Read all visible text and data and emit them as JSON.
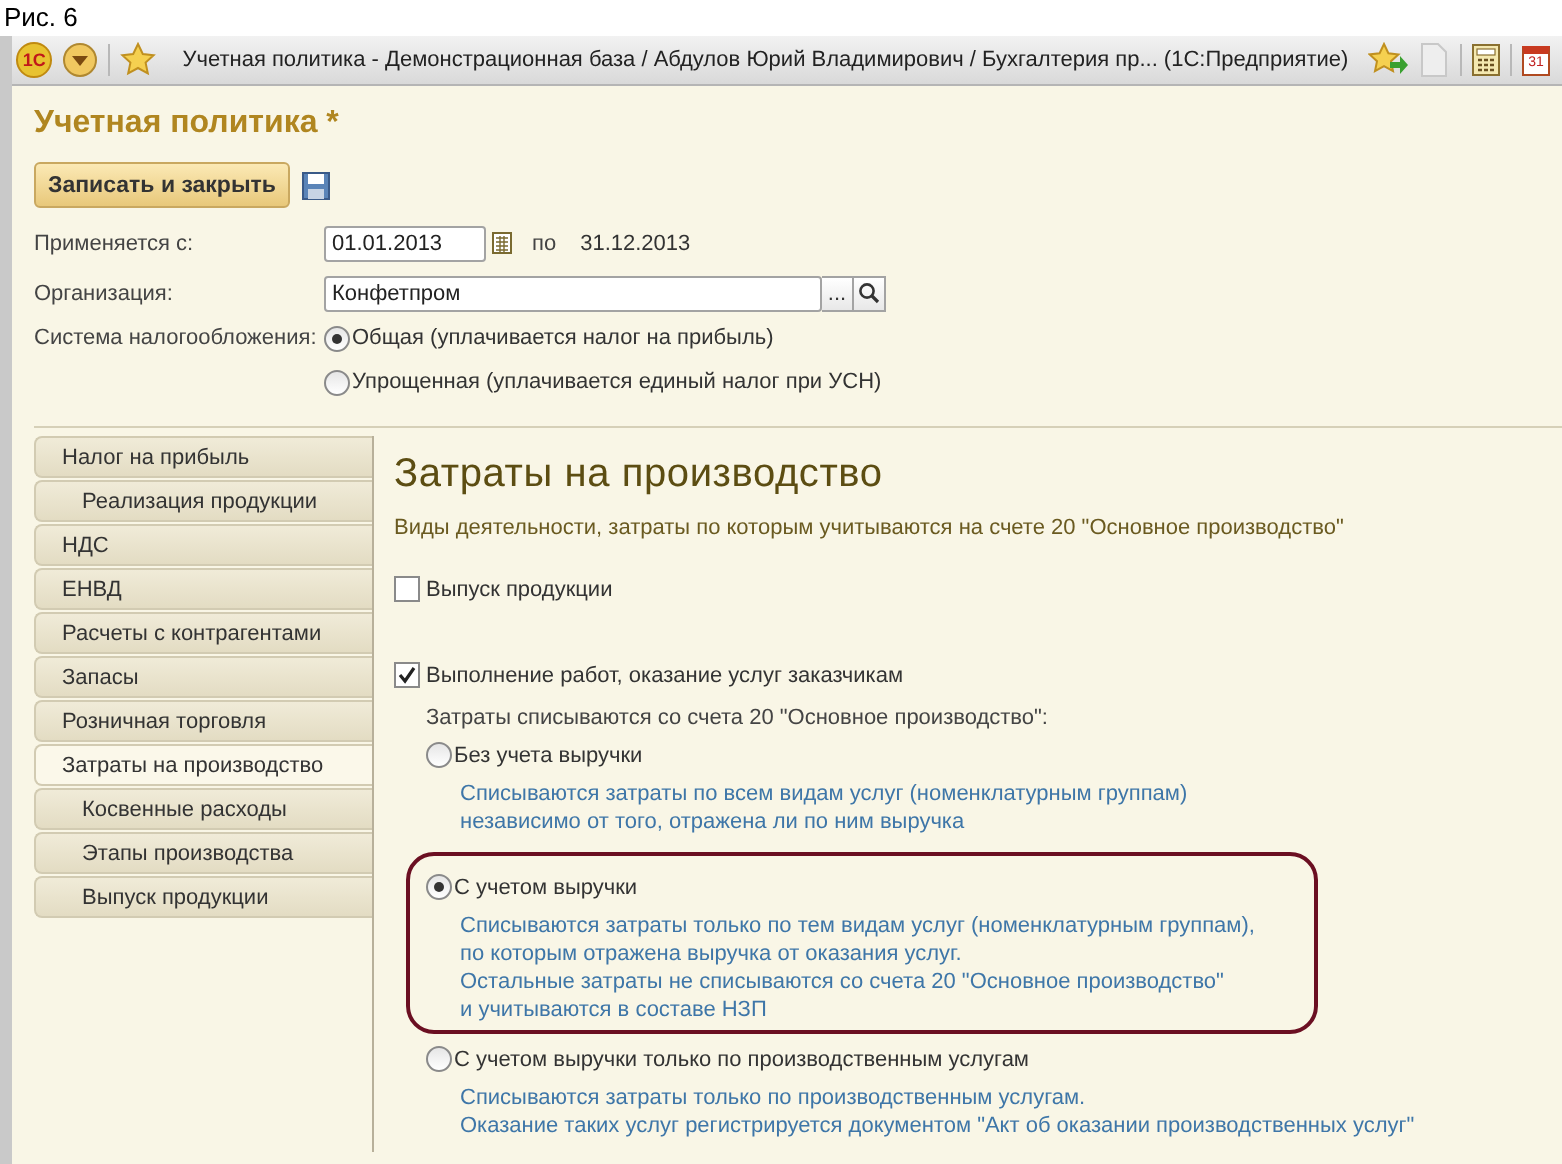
{
  "caption": "Рис. 6",
  "window": {
    "logo": "1С",
    "title": "Учетная политика - Демонстрационная база / Абдулов Юрий Владимирович / Бухгалтерия пр...  (1С:Предприятие)",
    "calendar_day": "31"
  },
  "form": {
    "title": "Учетная политика *",
    "save_close_button": "Записать и закрыть",
    "period": {
      "label": "Применяется с:",
      "from": "01.01.2013",
      "to_label": "по",
      "to": "31.12.2013"
    },
    "organization": {
      "label": "Организация:",
      "value": "Конфетпром",
      "select_button": "..."
    },
    "tax_system": {
      "label": "Система налогообложения:",
      "options": [
        {
          "label": "Общая (уплачивается налог на прибыль)",
          "selected": true
        },
        {
          "label": "Упрощенная (уплачивается единый налог при УСН)",
          "selected": false
        }
      ]
    }
  },
  "sections": [
    {
      "label": "Налог на прибыль",
      "selected": false,
      "children": [
        {
          "label": "Реализация продукции",
          "selected": false
        }
      ]
    },
    {
      "label": "НДС",
      "selected": false
    },
    {
      "label": "ЕНВД",
      "selected": false
    },
    {
      "label": "Расчеты с контрагентами",
      "selected": false
    },
    {
      "label": "Запасы",
      "selected": false
    },
    {
      "label": "Розничная торговля",
      "selected": false
    },
    {
      "label": "Затраты на производство",
      "selected": true,
      "children": [
        {
          "label": "Косвенные расходы",
          "selected": false
        },
        {
          "label": "Этапы производства",
          "selected": false
        },
        {
          "label": "Выпуск продукции",
          "selected": false
        }
      ]
    }
  ],
  "panel": {
    "heading": "Затраты на производство",
    "subtitle": "Виды деятельности, затраты по которым учитываются на счете 20 \"Основное производство\"",
    "activities": [
      {
        "label": "Выпуск продукции",
        "checked": false
      },
      {
        "label": "Выполнение работ, оказание услуг заказчикам",
        "checked": true
      }
    ],
    "writeoff_label": "Затраты списываются со счета 20 \"Основное производство\":",
    "writeoff_options": [
      {
        "label": "Без учета выручки",
        "selected": false,
        "highlighted": false,
        "description": [
          "Списываются затраты по всем видам услуг (номенклатурным группам)",
          "независимо от того, отражена ли по ним выручка"
        ]
      },
      {
        "label": "С учетом выручки",
        "selected": true,
        "highlighted": true,
        "description": [
          "Списываются затраты только по тем видам услуг (номенклатурным группам),",
          "по которым отражена выручка от оказания услуг.",
          "Остальные затраты не списываются со счета 20 \"Основное производство\"",
          "и учитываются в составе НЗП"
        ]
      },
      {
        "label": "С учетом выручки только по производственным услугам",
        "selected": false,
        "highlighted": false,
        "description": [
          "Списываются затраты только по производственным услугам.",
          "Оказание таких услуг регистрируется документом \"Акт об оказании производственных услуг\""
        ]
      }
    ]
  }
}
